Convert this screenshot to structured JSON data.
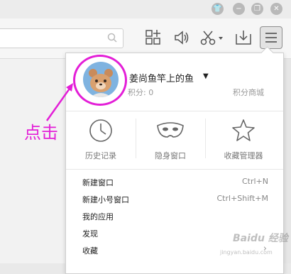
{
  "menu": {
    "username": "姜尚鱼竿上的鱼",
    "points": "积分: 0",
    "points_mall": "积分商城",
    "quick_actions": [
      {
        "label": "历史记录",
        "icon": "clock-icon"
      },
      {
        "label": "隐身窗口",
        "icon": "mask-icon"
      },
      {
        "label": "收藏管理器",
        "icon": "star-icon"
      }
    ],
    "items": [
      {
        "label": "新建窗口",
        "shortcut": "Ctrl+N"
      },
      {
        "label": "新建小号窗口",
        "shortcut": "Ctrl+Shift+M"
      },
      {
        "label": "我的应用",
        "shortcut": ""
      },
      {
        "label": "发现",
        "shortcut": ""
      },
      {
        "label": "收藏",
        "shortcut": ""
      }
    ]
  },
  "annotation": {
    "text": "点击",
    "color": "#e31ed7"
  },
  "colors": {
    "highlight": "#e31ed7",
    "window_bg": "#e9e9e9"
  },
  "watermark": {
    "name": "Baidu 经验",
    "sub": "jingyan.baidu.com"
  }
}
